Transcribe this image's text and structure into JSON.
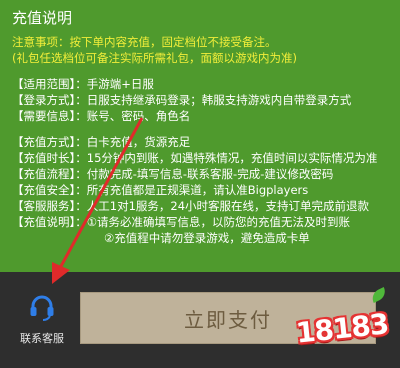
{
  "panel": {
    "title": "充值说明",
    "notice_line1": "注意事项：按下单内容充值，固定档位不接受备注。",
    "notice_line2": "(礼包任选档位可备注实际所需礼包，面额以游戏内为准)",
    "scope": "【适用范围】：手游端+日服",
    "login": "【登录方式】：日服支持继承码登录；韩服支持游戏内自带登录方式",
    "required": "【需要信息】：账号、密码、角色名",
    "method": "【充值方式】：白卡充值，货源充足",
    "duration": "【充值时长】：15分钟内到账，如遇特殊情况，充值时间以实际情况为准",
    "process": "【充值流程】：付款完成-填写信息-联系客服-完成-建议修改密码",
    "security": "【充值安全】：所有充值都是正规渠道，请认准Bigplayers",
    "service": "【客服服务】：人工1对1服务，24小时客服在线，支持订单完成前退款",
    "explain_label": "【充值说明】：",
    "explain_1": "①请务必准确填写信息，以防您的充值无法及时到账",
    "explain_2": "②充值程中请勿登录游戏，避免造成卡单"
  },
  "bottom_bar": {
    "support_label": "联系客服",
    "support_icon": "headset-icon",
    "pay_label": "立即支付"
  },
  "watermark": {
    "text": "18183"
  },
  "colors": {
    "panel_bg": "#4f9a2d",
    "notice_yellow": "#f2ee3a",
    "pay_button_bg": "#bfb29a",
    "arrow_red": "#e02a2a"
  }
}
